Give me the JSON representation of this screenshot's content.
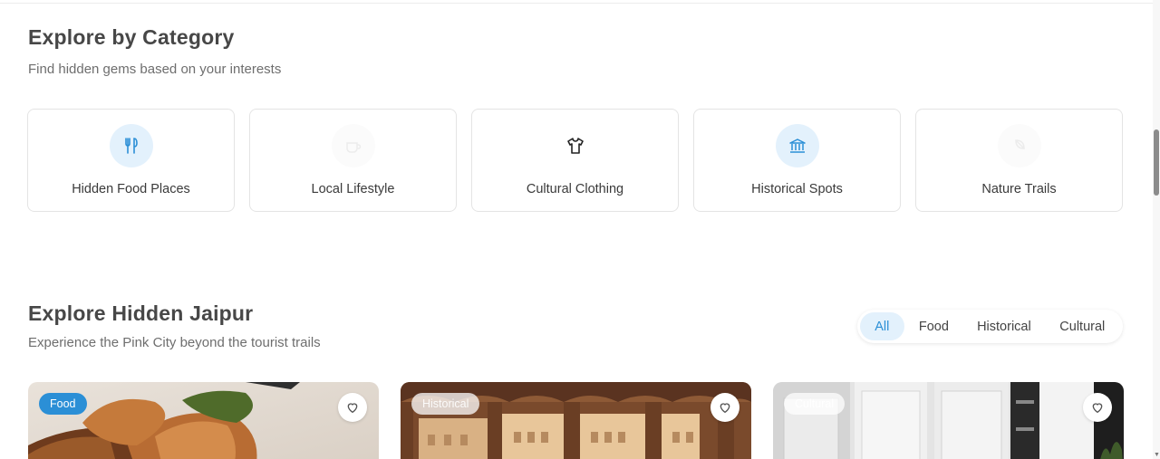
{
  "category_section": {
    "title": "Explore by Category",
    "subtitle": "Find hidden gems based on your interests",
    "categories": [
      {
        "label": "Hidden Food Places",
        "icon": "fork-knife-icon"
      },
      {
        "label": "Local Lifestyle",
        "icon": "coffee-cup-icon"
      },
      {
        "label": "Cultural Clothing",
        "icon": "shirt-icon"
      },
      {
        "label": "Historical Spots",
        "icon": "landmark-icon"
      },
      {
        "label": "Nature Trails",
        "icon": "leaf-icon"
      }
    ]
  },
  "jaipur_section": {
    "title": "Explore Hidden Jaipur",
    "subtitle": "Experience the Pink City beyond the tourist trails",
    "filters": [
      "All",
      "Food",
      "Historical",
      "Cultural"
    ],
    "active_filter": "All"
  },
  "places": [
    {
      "tag": "Food",
      "icon": "heart-icon"
    },
    {
      "tag": "Historical",
      "icon": "heart-icon"
    },
    {
      "tag": "Cultural",
      "icon": "heart-icon"
    }
  ],
  "colors": {
    "accent": "#2b8fd6",
    "accent_light": "#e3f1fc"
  }
}
